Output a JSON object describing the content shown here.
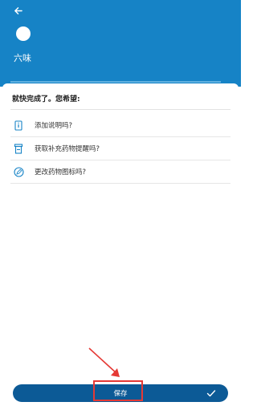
{
  "header": {
    "back_icon": "arrow-left-icon",
    "medication_name": "六味",
    "background_color": "#1683C6"
  },
  "sheet": {
    "title": "就快完成了。您希望:",
    "options": [
      {
        "icon": "document-info-icon",
        "label": "添加说明吗?"
      },
      {
        "icon": "pill-bottle-icon",
        "label": "获取补充药物提醒吗?"
      },
      {
        "icon": "pencil-circle-icon",
        "label": "更改药物图标吗?"
      }
    ]
  },
  "footer": {
    "save_label": "保存",
    "check_icon": "check-icon",
    "bar_color": "#0C5A96"
  },
  "annotation": {
    "highlight_color": "#E53935"
  }
}
